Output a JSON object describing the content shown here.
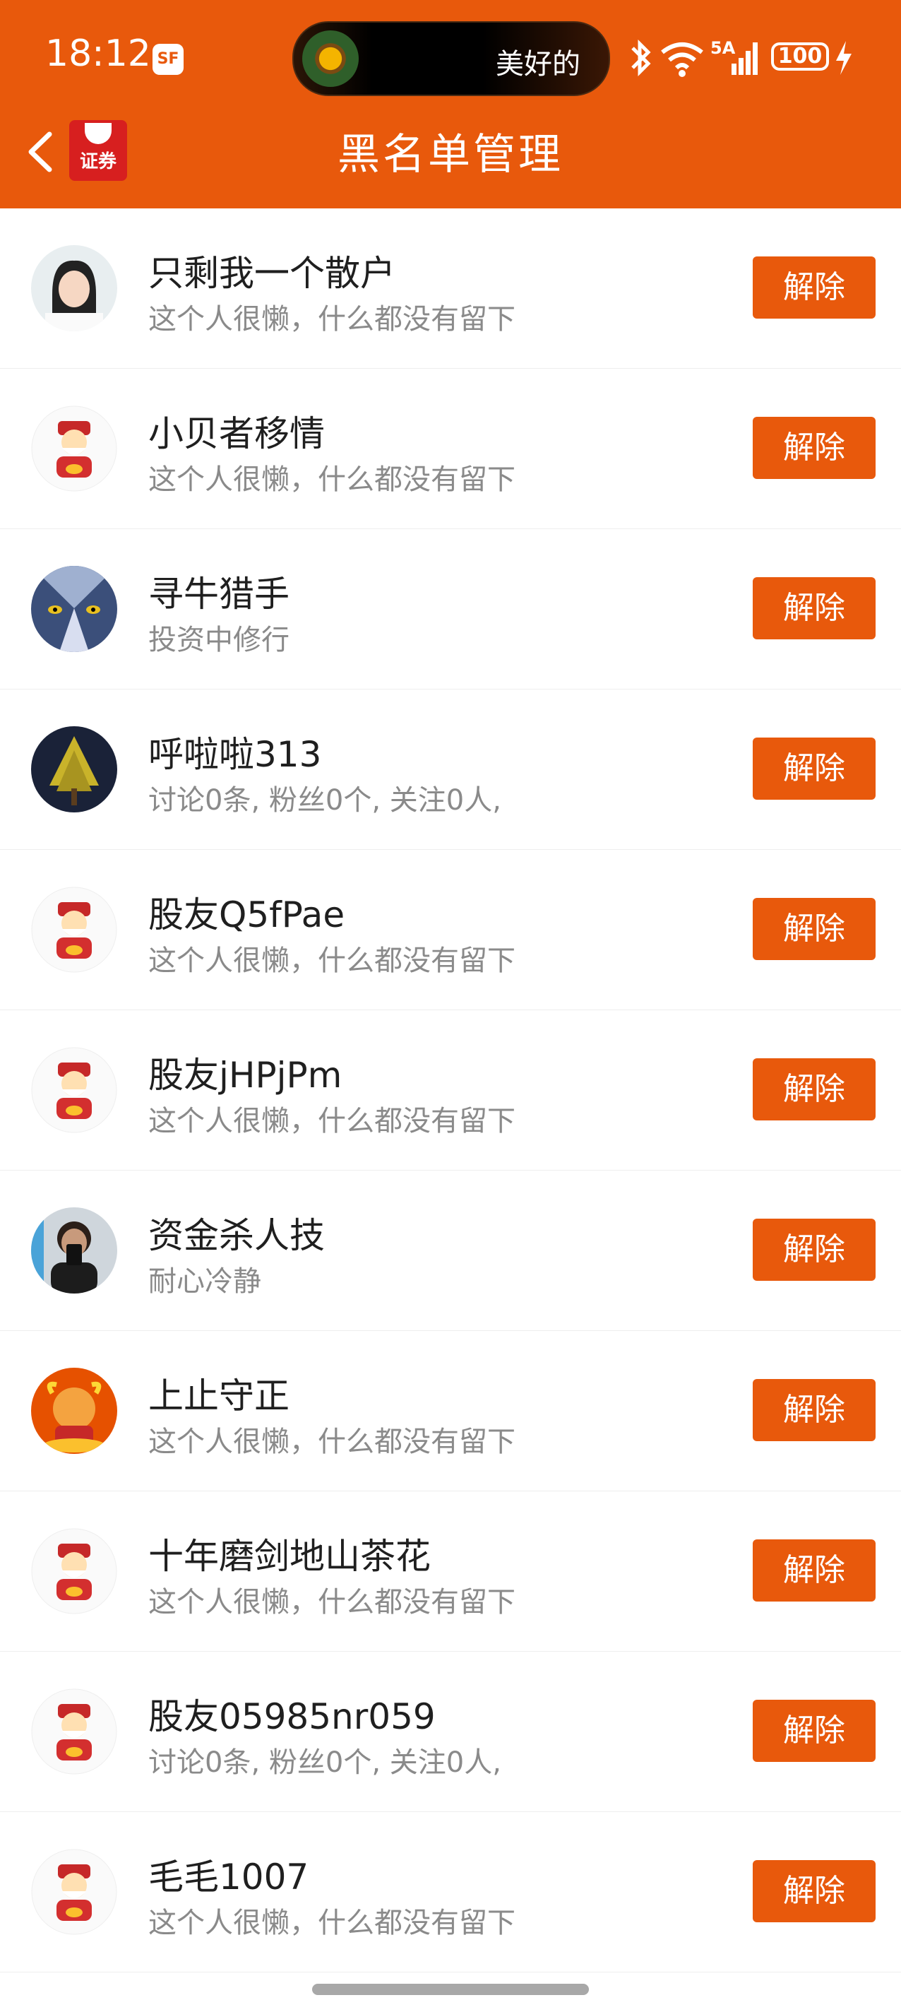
{
  "status_bar": {
    "time": "18:12",
    "sf_badge": "SF",
    "island_text": "美好的",
    "signal_label": "5A",
    "battery": "100"
  },
  "header": {
    "title": "黑名单管理",
    "logo_text": "证券"
  },
  "blacklist": [
    {
      "name": "只剩我一个散户",
      "desc": "这个人很懒，什么都没有留下",
      "button": "解除",
      "avatar": "avatar-photo-girl"
    },
    {
      "name": "小贝者移情",
      "desc": "这个人很懒，什么都没有留下",
      "button": "解除",
      "avatar": "avatar-fortune-god"
    },
    {
      "name": "寻牛猎手",
      "desc": "投资中修行",
      "button": "解除",
      "avatar": "avatar-wolf-eyes"
    },
    {
      "name": "呼啦啦313",
      "desc": "讨论0条, 粉丝0个, 关注0人,",
      "button": "解除",
      "avatar": "avatar-tree-night"
    },
    {
      "name": "股友Q5fPae",
      "desc": "这个人很懒，什么都没有留下",
      "button": "解除",
      "avatar": "avatar-fortune-god"
    },
    {
      "name": "股友jHPjPm",
      "desc": "这个人很懒，什么都没有留下",
      "button": "解除",
      "avatar": "avatar-fortune-god"
    },
    {
      "name": "资金杀人技",
      "desc": "耐心冷静",
      "button": "解除",
      "avatar": "avatar-person-selfie"
    },
    {
      "name": "上止守正",
      "desc": "这个人很懒，什么都没有留下",
      "button": "解除",
      "avatar": "avatar-golden-ox"
    },
    {
      "name": "十年磨剑地山茶花",
      "desc": "这个人很懒，什么都没有留下",
      "button": "解除",
      "avatar": "avatar-fortune-god"
    },
    {
      "name": "股友05985nr059",
      "desc": "讨论0条, 粉丝0个, 关注0人,",
      "button": "解除",
      "avatar": "avatar-fortune-god"
    },
    {
      "name": "毛毛1007",
      "desc": "这个人很懒，什么都没有留下",
      "button": "解除",
      "avatar": "avatar-fortune-god"
    }
  ],
  "colors": {
    "brand": "#E8590C",
    "name_text": "#1f1f1f",
    "desc_text": "#8a8a8a"
  }
}
